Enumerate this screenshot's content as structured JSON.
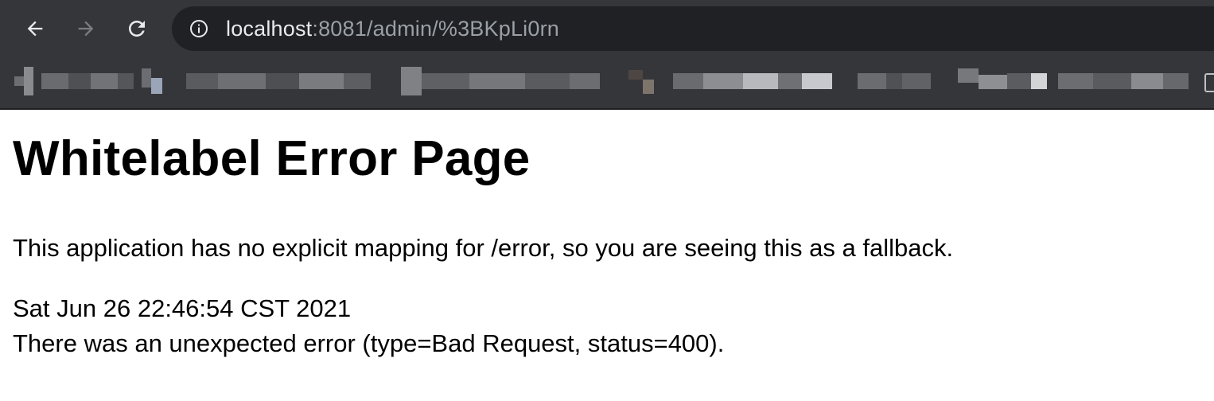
{
  "browser": {
    "url_host": "localhost",
    "url_rest": ":8081/admin/%3BKpLi0rn",
    "icons": {
      "back": "arrow-left-icon",
      "forward": "arrow-right-icon",
      "reload": "reload-icon",
      "site_info": "info-icon",
      "bookmark_overflow": "folder-icon"
    },
    "colors": {
      "chrome": "#35363a",
      "omnibox": "#202124",
      "url_host": "#e8eaed",
      "url_rest": "#9aa0a6",
      "forward_disabled": "#7a7c80"
    }
  },
  "page": {
    "title": "Whitelabel Error Page",
    "message": "This application has no explicit mapping for /error, so you are seeing this as a fallback.",
    "timestamp": "Sat Jun 26 22:46:54 CST 2021",
    "error": "There was an unexpected error (type=Bad Request, status=400)."
  }
}
